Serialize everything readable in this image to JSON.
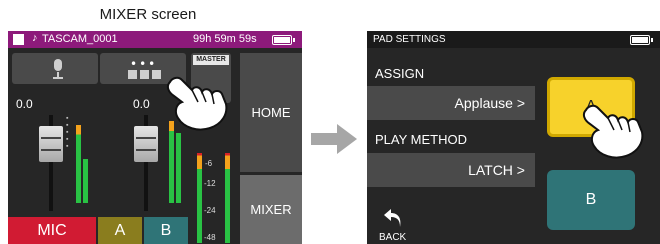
{
  "caption": "MIXER screen",
  "mixer": {
    "file_name": "TASCAM_0001",
    "remaining_time": "99h 59m 59s",
    "ch1_value": "0.0",
    "ch2_value": "0.0",
    "master_label": "MASTER",
    "home_label": "HOME",
    "mixer_label": "MIXER",
    "tab_mic": "MIC",
    "tab_a": "A",
    "tab_b": "B",
    "db_scale": [
      "-6",
      "-12",
      "-24",
      "-48"
    ],
    "ch_scale": [
      "6",
      "0",
      "-6",
      "-12",
      "-24"
    ]
  },
  "pad_settings": {
    "title": "PAD SETTINGS",
    "assign_label": "ASSIGN",
    "assign_value": "Applause >",
    "play_method_label": "PLAY METHOD",
    "play_method_value": "LATCH >",
    "pad_a": "A",
    "pad_b": "B",
    "back_label": "BACK"
  },
  "colors": {
    "topbar_purple": "#8d1a7b",
    "mic_tab": "#d11b33",
    "a_tab": "#8a7d1e",
    "b_tab": "#2f7477",
    "pad_a": "#f7d22b",
    "pad_b": "#2f7477",
    "meter_green": "#29c244",
    "meter_orange": "#f4a21c",
    "meter_red": "#d92226"
  }
}
